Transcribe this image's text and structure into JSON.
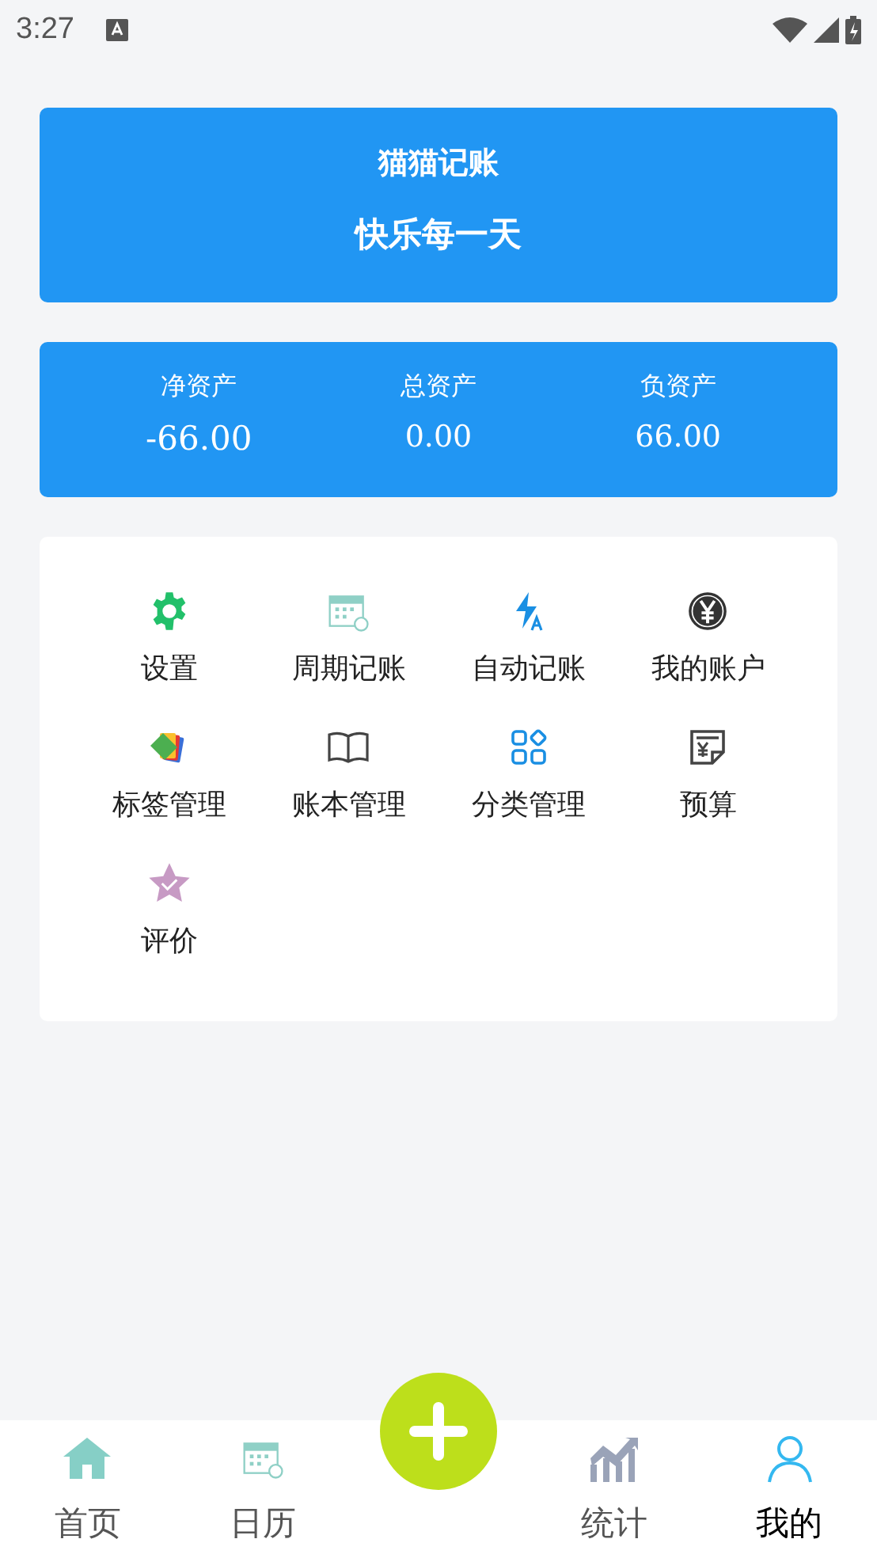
{
  "status_bar": {
    "time": "3:27"
  },
  "header": {
    "title": "猫猫记账",
    "subtitle": "快乐每一天"
  },
  "assets": [
    {
      "label": "净资产",
      "value": "-66.00"
    },
    {
      "label": "总资产",
      "value": "0.00"
    },
    {
      "label": "负资产",
      "value": "66.00"
    }
  ],
  "menu": [
    {
      "kind": "gear",
      "label": "设置"
    },
    {
      "kind": "calendar",
      "label": "周期记账"
    },
    {
      "kind": "bolt",
      "label": "自动记账"
    },
    {
      "kind": "yen",
      "label": "我的账户"
    },
    {
      "kind": "tags",
      "label": "标签管理"
    },
    {
      "kind": "book",
      "label": "账本管理"
    },
    {
      "kind": "grid",
      "label": "分类管理"
    },
    {
      "kind": "receipt",
      "label": "预算"
    },
    {
      "kind": "star",
      "label": "评价"
    }
  ],
  "bottom_nav": [
    {
      "kind": "home",
      "label": "首页",
      "selected": false
    },
    {
      "kind": "calendar",
      "label": "日历",
      "selected": false
    },
    {
      "kind": "add"
    },
    {
      "kind": "chart",
      "label": "统计",
      "selected": false
    },
    {
      "kind": "person",
      "label": "我的",
      "selected": true
    }
  ]
}
